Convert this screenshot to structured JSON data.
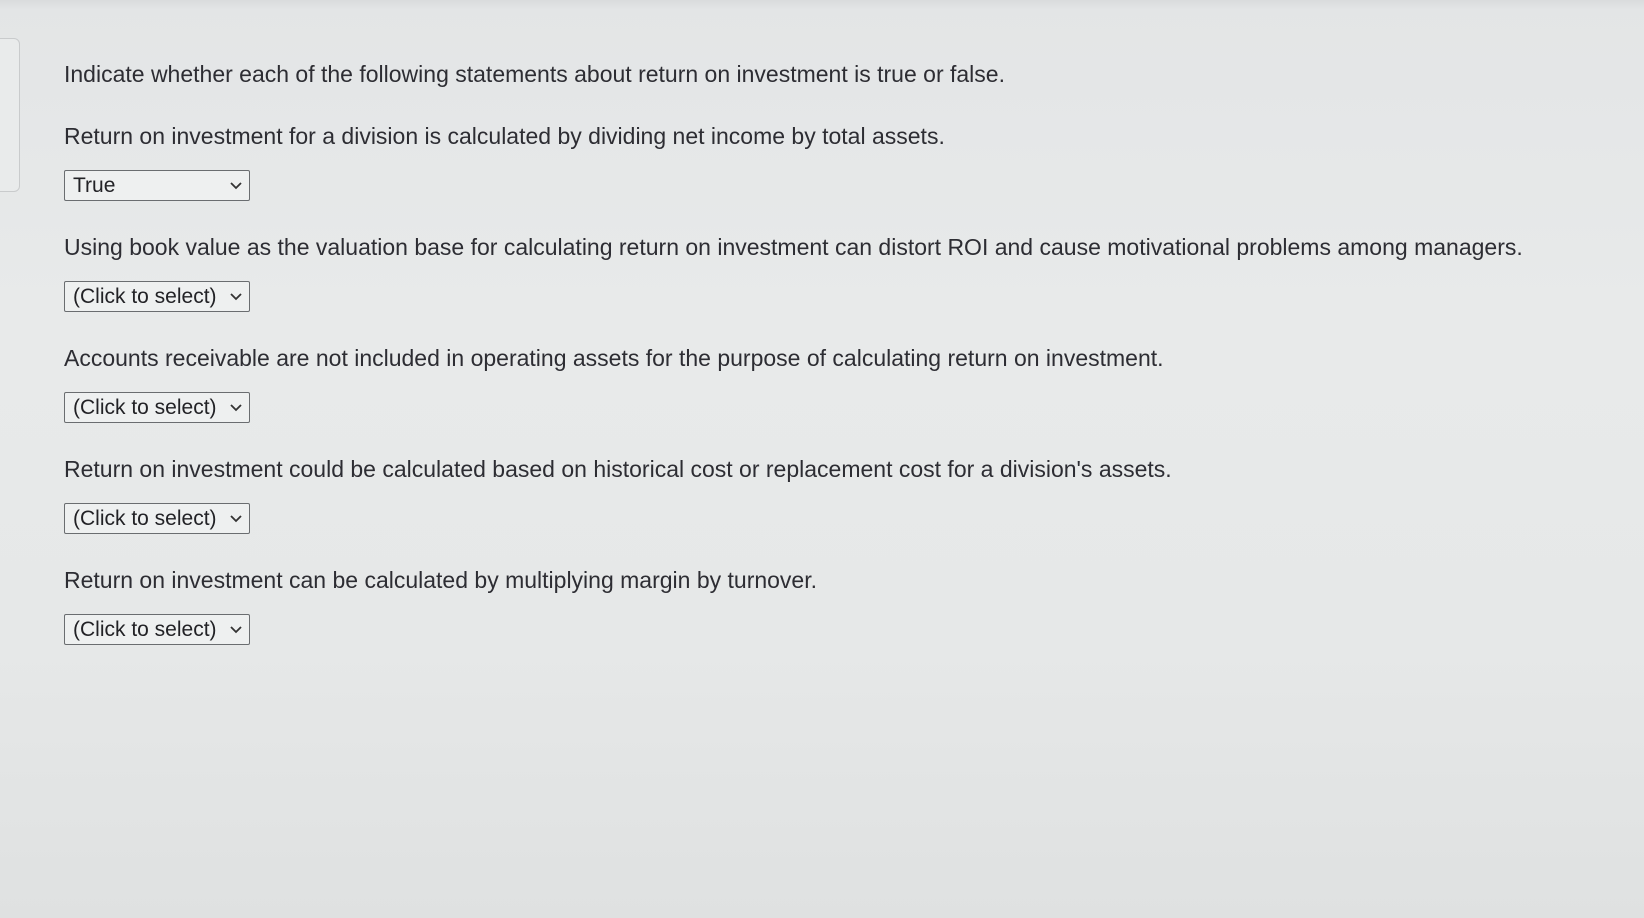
{
  "instruction": "Indicate whether each of the following statements about return on investment is true or false.",
  "questions": [
    {
      "statement": "Return on investment for a division is calculated by dividing net income by total assets.",
      "selected": "True"
    },
    {
      "statement": "Using book value as the valuation base for calculating return on investment can distort ROI and cause motivational problems among managers.",
      "selected": "(Click to select)"
    },
    {
      "statement": "Accounts receivable are not included in operating assets for the purpose of calculating return on investment.",
      "selected": "(Click to select)"
    },
    {
      "statement": "Return on investment could be calculated based on historical cost or replacement cost for a division's assets.",
      "selected": "(Click to select)"
    },
    {
      "statement": "Return on investment can be calculated by multiplying margin by turnover.",
      "selected": "(Click to select)"
    }
  ],
  "icons": {
    "dropdown": "chevron-down-icon"
  }
}
